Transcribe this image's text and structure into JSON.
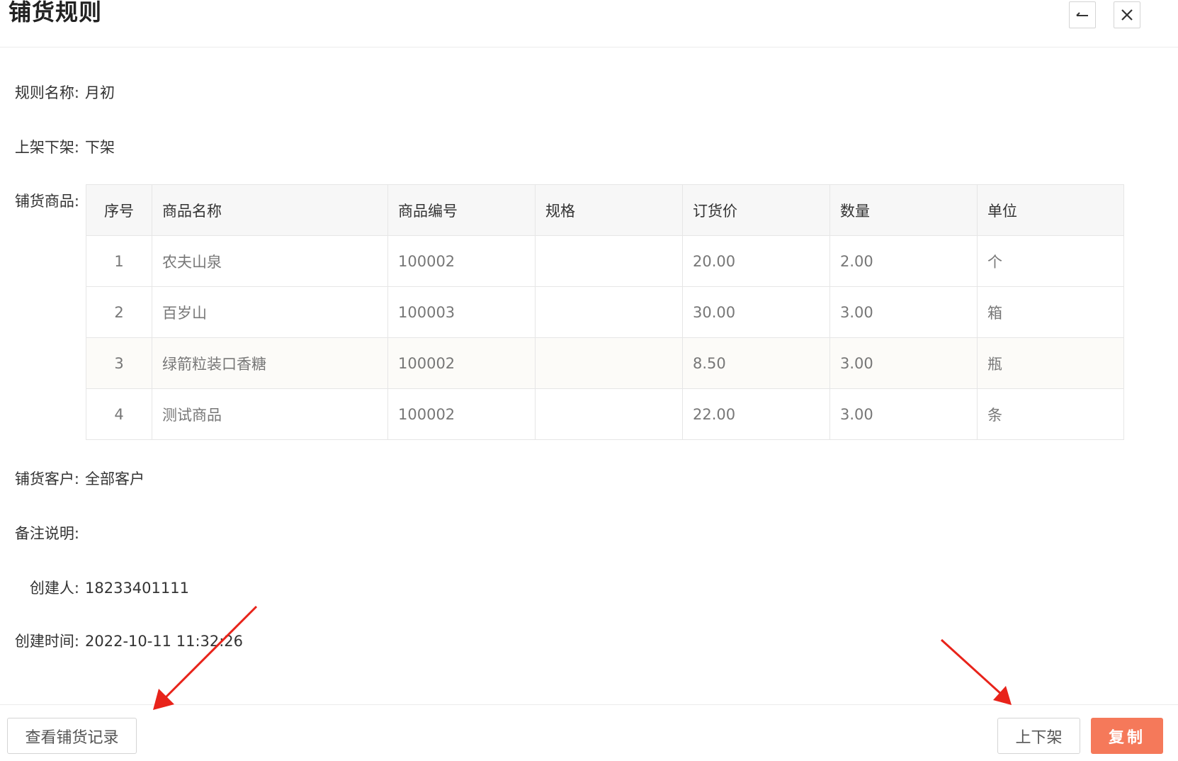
{
  "header": {
    "title": "铺货规则",
    "back_icon": "arrow-left-icon",
    "close_icon": "close-icon"
  },
  "fields": {
    "rule_name": {
      "label": "规则名称:",
      "value": "月初"
    },
    "listing": {
      "label": "上架下架:",
      "value": "下架"
    },
    "goods": {
      "label": "铺货商品:"
    },
    "customers": {
      "label": "铺货客户:",
      "value": "全部客户"
    },
    "remark": {
      "label": "备注说明:",
      "value": ""
    },
    "creator": {
      "label": "创建人:",
      "value": "18233401111"
    },
    "created_at": {
      "label": "创建时间:",
      "value": "2022-10-11 11:32:26"
    }
  },
  "table": {
    "columns": [
      "序号",
      "商品名称",
      "商品编号",
      "规格",
      "订货价",
      "数量",
      "单位"
    ],
    "rows": [
      [
        "1",
        "农夫山泉",
        "100002",
        "",
        "20.00",
        "2.00",
        "个"
      ],
      [
        "2",
        "百岁山",
        "100003",
        "",
        "30.00",
        "3.00",
        "箱"
      ],
      [
        "3",
        "绿箭粒装口香糖",
        "100002",
        "",
        "8.50",
        "3.00",
        "瓶"
      ],
      [
        "4",
        "测试商品",
        "100002",
        "",
        "22.00",
        "3.00",
        "条"
      ]
    ]
  },
  "footer": {
    "records_label": "查看铺货记录",
    "toggle_label": "上下架",
    "copy_label": "复制"
  },
  "colors": {
    "primary": "#f5795a",
    "annotation_arrow": "#e8231a",
    "header_bg": "#f7f7f7"
  }
}
